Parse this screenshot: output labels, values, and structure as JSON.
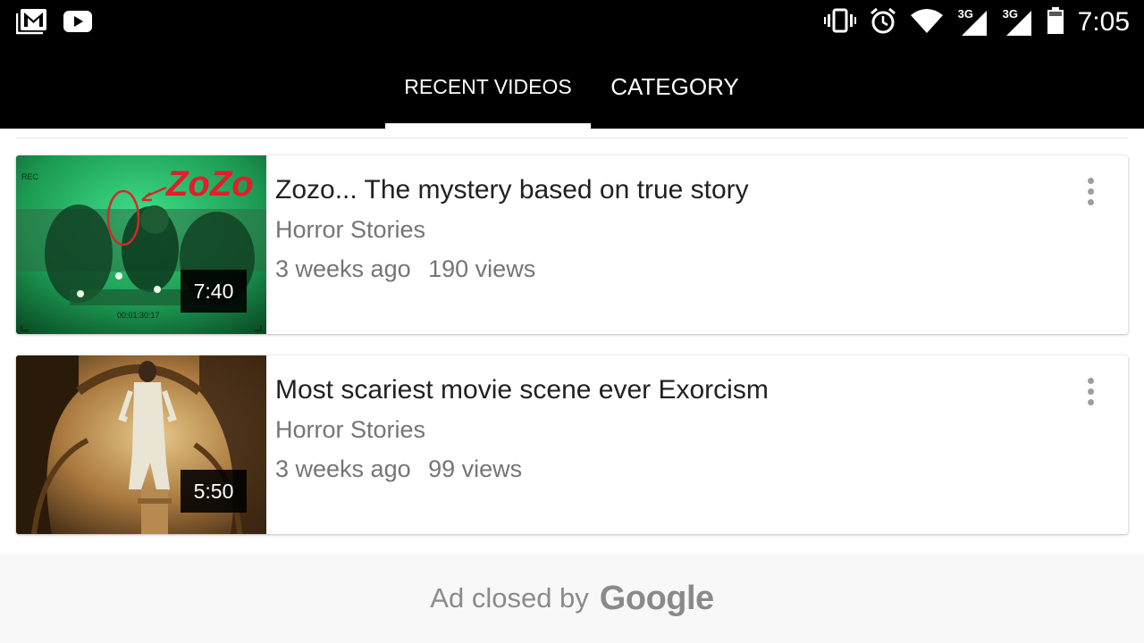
{
  "status_bar": {
    "time": "7:05",
    "network_1": "3G",
    "network_2": "3G",
    "left_icons": [
      "gmail-icon",
      "youtube-icon"
    ],
    "right_icons": [
      "vibrate-icon",
      "alarm-icon",
      "wifi-icon",
      "signal-icon",
      "signal-icon",
      "battery-icon"
    ]
  },
  "tabs": [
    {
      "label": "RECENT VIDEOS",
      "selected": true
    },
    {
      "label": "CATEGORY",
      "selected": false
    }
  ],
  "videos": [
    {
      "title": "Zozo... The mystery based on true story",
      "channel": "Horror Stories",
      "age": "3 weeks ago",
      "views": "190 views",
      "duration": "7:40",
      "thumbnail_overlay_text": "ZoZo",
      "thumbnail_rec": "REC",
      "thumbnail_timestamp": "00:01:30:17"
    },
    {
      "title": "Most scariest movie scene ever Exorcism",
      "channel": "Horror Stories",
      "age": "3 weeks ago",
      "views": "99 views",
      "duration": "5:50"
    }
  ],
  "ad": {
    "text": "Ad closed by",
    "brand": "Google"
  },
  "colors": {
    "status_bar_bg": "#000000",
    "tab_bar_bg": "#000000",
    "tab_indicator": "#ffffff",
    "title_text": "#212121",
    "secondary_text": "#757575",
    "ad_bg": "#f8f8f8"
  }
}
